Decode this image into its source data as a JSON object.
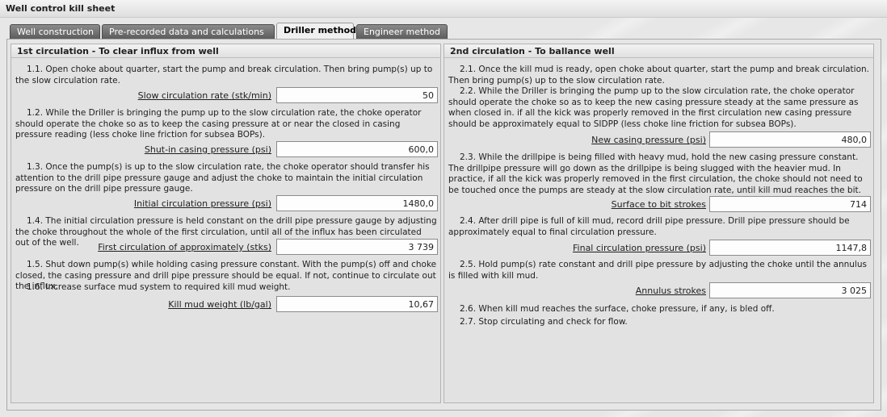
{
  "window": {
    "title": "Well control kill sheet"
  },
  "tabs": [
    {
      "label": "Well construction"
    },
    {
      "label": "Pre-recorded data and calculations"
    },
    {
      "label": "Driller method"
    },
    {
      "label": "Engineer method"
    }
  ],
  "left": {
    "title": "1st circulation - To clear influx from well",
    "p1_1": "1.1. Open choke about quarter, start the pump and break circulation. Then bring pump(s) up to the slow circulation rate.",
    "f1_label": "Slow circulation rate (stk/min)",
    "f1_value": "50",
    "p1_2": "1.2. While the Driller is bringing the pump up to the slow circulation rate, the choke operator should operate the choke so as to keep the casing pressure at or near the closed in casing pressure reading (less choke line friction for subsea BOPs).",
    "f2_label": "Shut-in casing pressure (psi)",
    "f2_value": "600,0",
    "p1_3": "1.3. Once the pump(s) is up to the slow circulation rate, the choke operator should transfer his attention to the drill pipe pressure gauge and adjust the choke to maintain the initial circulation pressure on the drill pipe pressure gauge.",
    "f3_label": "Initial circulation pressure (psi)",
    "f3_value": "1480,0",
    "p1_4": "1.4. The initial circulation pressure is held constant on the drill pipe pressure gauge by adjusting the choke throughout the whole of the first circulation, until all of the influx has been circulated out of the well.",
    "f4_label": "First circulation of approximately (stks)",
    "f4_value": "3 739",
    "p1_5": "1.5. Shut down pump(s) while holding casing pressure constant. With the pump(s) off and choke closed, the casing pressure and drill pipe pressure should be equal. If not, continue to circulate out the influx.",
    "p1_6": "1.6. Increase surface mud system to required kill mud weight.",
    "f5_label": "Kill mud weight (lb/gal)",
    "f5_value": "10,67"
  },
  "right": {
    "title": "2nd circulation - To ballance well",
    "p2_1": "2.1. Once the kill mud is ready, open choke about quarter, start the pump and break circulation. Then bring pump(s) up to the slow circulation rate.",
    "p2_2": "2.2. While the Driller is bringing the pump up to the slow circulation rate, the choke operator should operate the choke so as to keep the new casing pressure steady at the same pressure as when closed in. if all the kick was properly removed in the first circulation new casing pressure should be approximately equal to SIDPP (less choke line friction for subsea BOPs).",
    "f1_label": "New casing pressure (psi)",
    "f1_value": "480,0",
    "p2_3": "2.3. While the drillpipe is being filled with heavy mud, hold the new casing pressure constant. The drillpipe pressure will go down as the drillpipe is being slugged with the heavier mud. In practice, if all the kick was properly removed in the first circulation, the choke should not need to be touched once the pumps are steady at the slow circulation rate, until kill mud reaches the bit.",
    "f2_label": "Surface to bit strokes",
    "f2_value": "714",
    "p2_4": "2.4. After drill pipe is full of kill mud, record drill pipe pressure. Drill pipe pressure  should be approximately equal to final circulation pressure.",
    "f3_label": "Final circulation pressure (psi)",
    "f3_value": "1147,8",
    "p2_5": "2.5. Hold pump(s) rate constant and drill pipe pressure by adjusting the choke until the annulus is filled with kill mud.",
    "f4_label": "Annulus strokes",
    "f4_value": "3 025",
    "p2_6": "2.6. When kill mud reaches the surface, choke pressure, if any, is bled off.",
    "p2_7": "2.7. Stop circulating and check for flow."
  }
}
